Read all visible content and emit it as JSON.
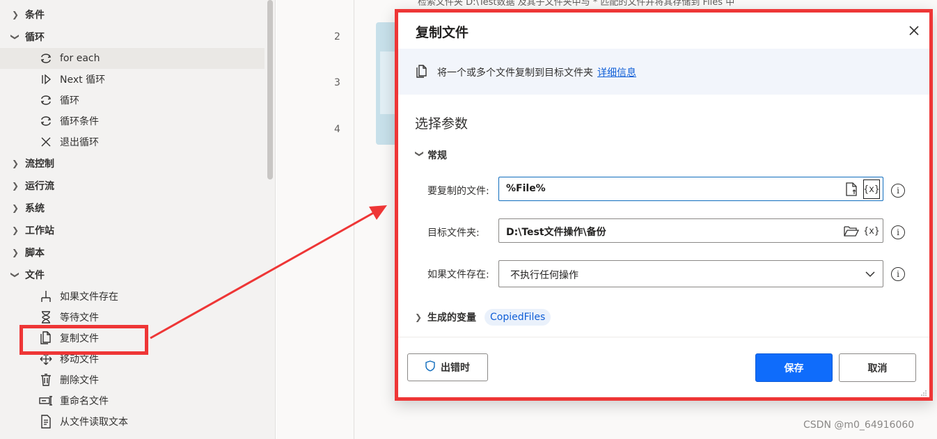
{
  "sidebar": {
    "categories": [
      {
        "label": "条件",
        "expanded": false
      },
      {
        "label": "循环",
        "expanded": true
      },
      {
        "label": "流控制",
        "expanded": false
      },
      {
        "label": "运行流",
        "expanded": false
      },
      {
        "label": "系统",
        "expanded": false
      },
      {
        "label": "工作站",
        "expanded": false
      },
      {
        "label": "脚本",
        "expanded": false
      },
      {
        "label": "文件",
        "expanded": true
      }
    ],
    "loop_actions": [
      {
        "label": "for each",
        "icon": "loop-icon"
      },
      {
        "label": "Next 循环",
        "icon": "next-loop-icon"
      },
      {
        "label": "循环",
        "icon": "loop-icon"
      },
      {
        "label": "循环条件",
        "icon": "loop-icon"
      },
      {
        "label": "退出循环",
        "icon": "close-icon"
      }
    ],
    "file_actions": [
      {
        "label": "如果文件存在",
        "icon": "if-file-exists-icon"
      },
      {
        "label": "等待文件",
        "icon": "hourglass-icon"
      },
      {
        "label": "复制文件",
        "icon": "copy-file-icon"
      },
      {
        "label": "移动文件",
        "icon": "move-icon"
      },
      {
        "label": "删除文件",
        "icon": "trash-icon"
      },
      {
        "label": "重命名文件",
        "icon": "rename-icon"
      },
      {
        "label": "从文件读取文本",
        "icon": "read-file-icon"
      }
    ]
  },
  "flow": {
    "line_numbers": [
      "2",
      "3",
      "4"
    ],
    "top_text": "检索文件夹 D:\\Test数据 及其子文件夹中与 * 匹配的文件并将其存储到 Files 中"
  },
  "dialog": {
    "title": "复制文件",
    "info_text": "将一个或多个文件复制到目标文件夹",
    "info_link": "详细信息",
    "params_title": "选择参数",
    "general_section": "常规",
    "fields": {
      "files_label": "要复制的文件:",
      "files_value": "%File%",
      "dest_label": "目标文件夹:",
      "dest_value": "D:\\Test文件操作\\备份",
      "exists_label": "如果文件存在:",
      "exists_value": "不执行任何操作"
    },
    "var_icon_text": "{x}",
    "info_glyph": "i",
    "vars_section": "生成的变量",
    "var_chip": "CopiedFiles",
    "on_error_label": "出错时",
    "save_label": "保存",
    "cancel_label": "取消"
  },
  "annotation_colors": {
    "highlight": "#ee3636",
    "accent": "#0f6cfb"
  },
  "watermark": "CSDN @m0_64916060"
}
